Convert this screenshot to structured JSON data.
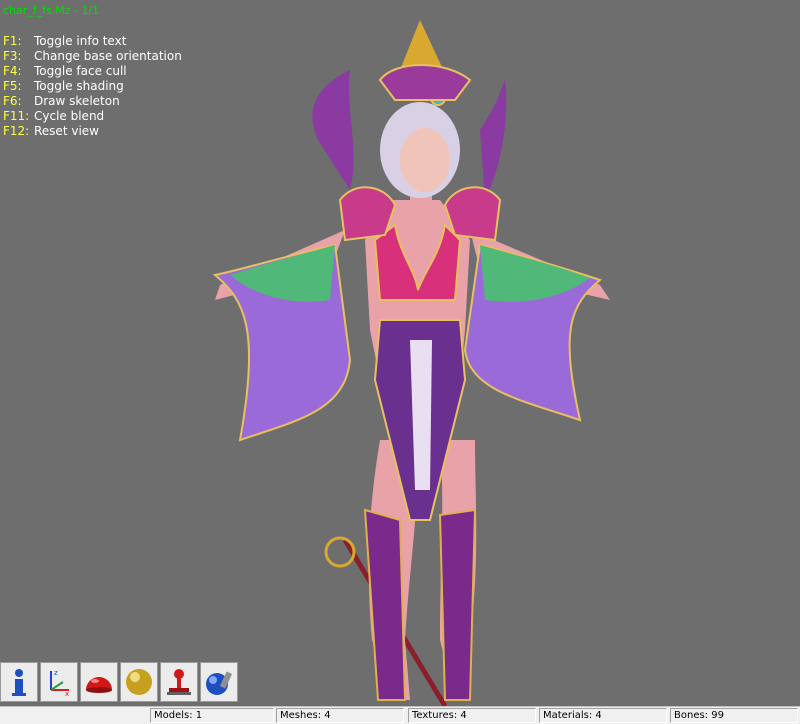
{
  "viewer": {
    "title": "char_f_fs.Mz - 1/1",
    "shortcuts": [
      {
        "key": "F1:",
        "label": "Toggle info text"
      },
      {
        "key": "F3:",
        "label": "Change base orientation"
      },
      {
        "key": "F4:",
        "label": "Toggle face cull"
      },
      {
        "key": "F5:",
        "label": "Toggle shading"
      },
      {
        "key": "F6:",
        "label": "Draw skeleton"
      },
      {
        "key": "F11:",
        "label": "Cycle blend"
      },
      {
        "key": "F12:",
        "label": "Reset view"
      }
    ]
  },
  "toolbar": {
    "buttons": [
      {
        "icon": "info-icon"
      },
      {
        "icon": "axes-icon"
      },
      {
        "icon": "red-hemisphere-icon"
      },
      {
        "icon": "gold-sphere-icon"
      },
      {
        "icon": "joystick-icon"
      },
      {
        "icon": "blue-sphere-brush-icon"
      }
    ]
  },
  "statusbar": {
    "models": "Models: 1",
    "meshes": "Meshes: 4",
    "textures": "Textures: 4",
    "materials": "Materials: 4",
    "bones": "Bones: 99"
  }
}
